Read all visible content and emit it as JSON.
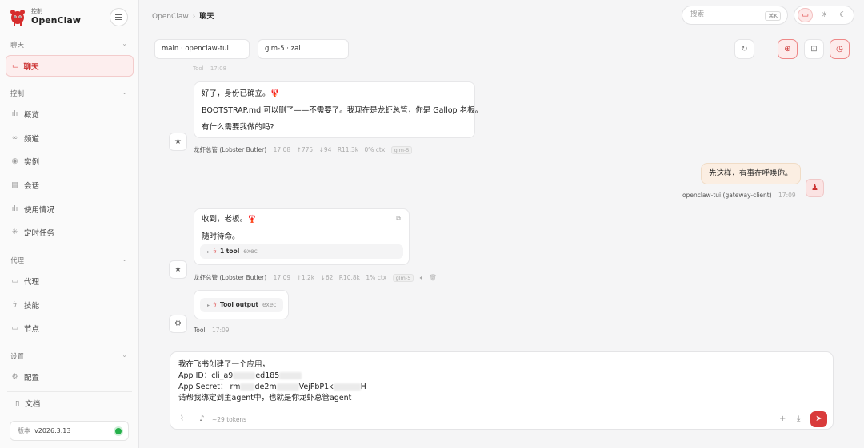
{
  "brand": {
    "small": "控制",
    "name": "OpenClaw"
  },
  "sidebar": {
    "sections": [
      {
        "label": "聊天"
      },
      {
        "label": "控制"
      },
      {
        "label": "代理"
      },
      {
        "label": "设置"
      }
    ],
    "active_item": {
      "label": "聊天",
      "icon": "chat-bubble-icon"
    },
    "control_items": [
      {
        "label": "概览",
        "icon": "bar-chart-icon"
      },
      {
        "label": "频道",
        "icon": "link-icon"
      },
      {
        "label": "实例",
        "icon": "radio-signal-icon"
      },
      {
        "label": "会话",
        "icon": "document-icon"
      },
      {
        "label": "使用情况",
        "icon": "bar-chart-icon"
      },
      {
        "label": "定时任务",
        "icon": "loader-icon"
      }
    ],
    "agent_items": [
      {
        "label": "代理",
        "icon": "folder-icon"
      },
      {
        "label": "技能",
        "icon": "lightning-icon"
      },
      {
        "label": "节点",
        "icon": "monitor-icon"
      }
    ],
    "settings_items": [
      {
        "label": "配置",
        "icon": "gear-icon"
      }
    ],
    "docs": {
      "label": "文档",
      "icon": "book-icon"
    },
    "version": {
      "label": "版本",
      "value": "v2026.3.13",
      "status_color": "#25b04a"
    }
  },
  "topbar": {
    "breadcrumb": [
      "OpenClaw",
      "聊天"
    ],
    "search": {
      "placeholder": "搜索",
      "shortcut": "⌘K"
    },
    "theme_buttons": [
      "monitor-icon",
      "sun-icon",
      "moon-icon"
    ]
  },
  "session": {
    "session_select": "main · openclaw-tui",
    "model_select": "glm-5 · zai"
  },
  "messages": {
    "faded_top": {
      "who": "Tool",
      "time": "17:08"
    },
    "assistant1": {
      "lines": [
        "好了，身份已确立。🦞",
        "BOOTSTRAP.md 可以删了——不需要了。我现在是龙虾总管，你是 Gallop 老板。",
        "有什么需要我做的吗?"
      ],
      "who": "龙虾总管 (Lobster Butler)",
      "time": "17:08",
      "in_tokens": "↑775",
      "out_tokens": "↓94",
      "cache": "R11.3k",
      "ctx": "0% ctx",
      "model": "glm-5"
    },
    "user1": {
      "text": "先这样，有事在呼唤你。",
      "who": "openclaw-tui (gateway-client)",
      "time": "17:09"
    },
    "assistant2": {
      "lines": [
        "收到，老板。🦞",
        "随时待命。"
      ],
      "tool": {
        "name": "1 tool",
        "kind": "exec"
      },
      "who": "龙虾总管 (Lobster Butler)",
      "time": "17:09",
      "in_tokens": "↑1.2k",
      "out_tokens": "↓62",
      "cache": "R10.8k",
      "ctx": "1% ctx",
      "model": "glm-5"
    },
    "tool1": {
      "tool": {
        "name": "Tool output",
        "kind": "exec"
      },
      "who": "Tool",
      "time": "17:09"
    }
  },
  "composer": {
    "line1": "我在飞书创建了一个应用，",
    "line2_a": "App ID：cli_a9",
    "line2_b": "ed185",
    "line3_a": "App Secret：  rm",
    "line3_b": "de2m",
    "line3_c": "VejFbP1k",
    "line3_d": "H",
    "line4": "请帮我绑定到主agent中，也就是你龙虾总管agent",
    "tokens": "~29 tokens"
  }
}
